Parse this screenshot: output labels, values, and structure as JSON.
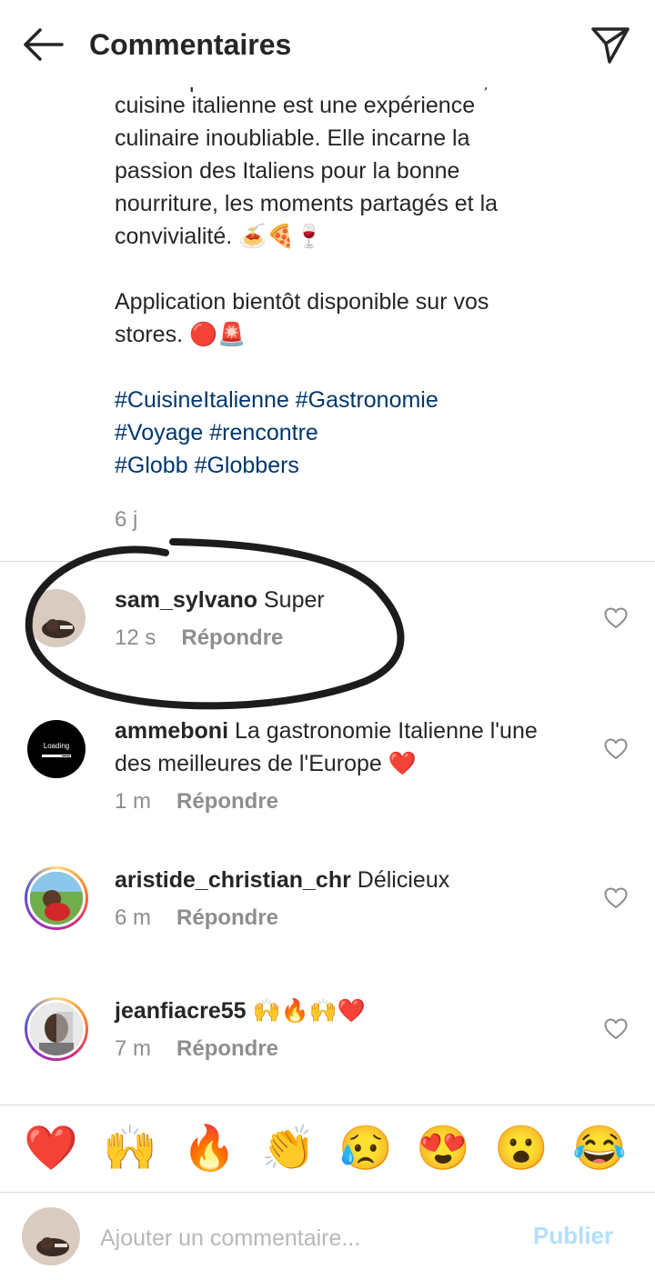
{
  "header": {
    "title": "Commentaires",
    "back_icon": "arrow-left-icon",
    "send_icon": "paper-plane-icon"
  },
  "caption": {
    "line_cut": "ou des pâtes à la carbonara à Rome, la",
    "lines": [
      "cuisine italienne est une expérience",
      "culinaire inoubliable. Elle incarne la",
      "passion des Italiens pour la bonne",
      "nourriture, les moments partagés et la",
      "convivialité. 🍝🍕🍷"
    ],
    "paragraph2": [
      "Application bientôt disponible sur vos",
      "stores. 🔴🚨"
    ],
    "hashtags": [
      "#CuisineItalienne",
      "#Gastronomie",
      "#Voyage",
      "#rencontre",
      "#Globb",
      "#Globbers"
    ],
    "time": "6 j"
  },
  "comments": [
    {
      "user": "sam_sylvano",
      "text": "Super",
      "time": "12 s",
      "reply": "Répondre"
    },
    {
      "user": "ammeboni",
      "text": "La gastronomie Italienne l'une des meilleures de l'Europe ❤️",
      "time": "1 m",
      "reply": "Répondre",
      "avatar_text": "Loading"
    },
    {
      "user": "aristide_christian_chr",
      "text": "Délicieux",
      "time": "6 m",
      "reply": "Répondre"
    },
    {
      "user": "jeanfiacre55",
      "text": "🙌🔥🙌❤️",
      "time": "7 m",
      "reply": "Répondre"
    }
  ],
  "reactions": [
    "❤️",
    "🙌",
    "🔥",
    "👏",
    "😥",
    "😍",
    "😮",
    "😂"
  ],
  "input": {
    "placeholder": "Ajouter un commentaire...",
    "publish_label": "Publier"
  },
  "colors": {
    "hashtag": "#00376b",
    "meta": "#8e8e8e",
    "publish_disabled": "#b2dffc",
    "divider": "#dbdbdb"
  }
}
